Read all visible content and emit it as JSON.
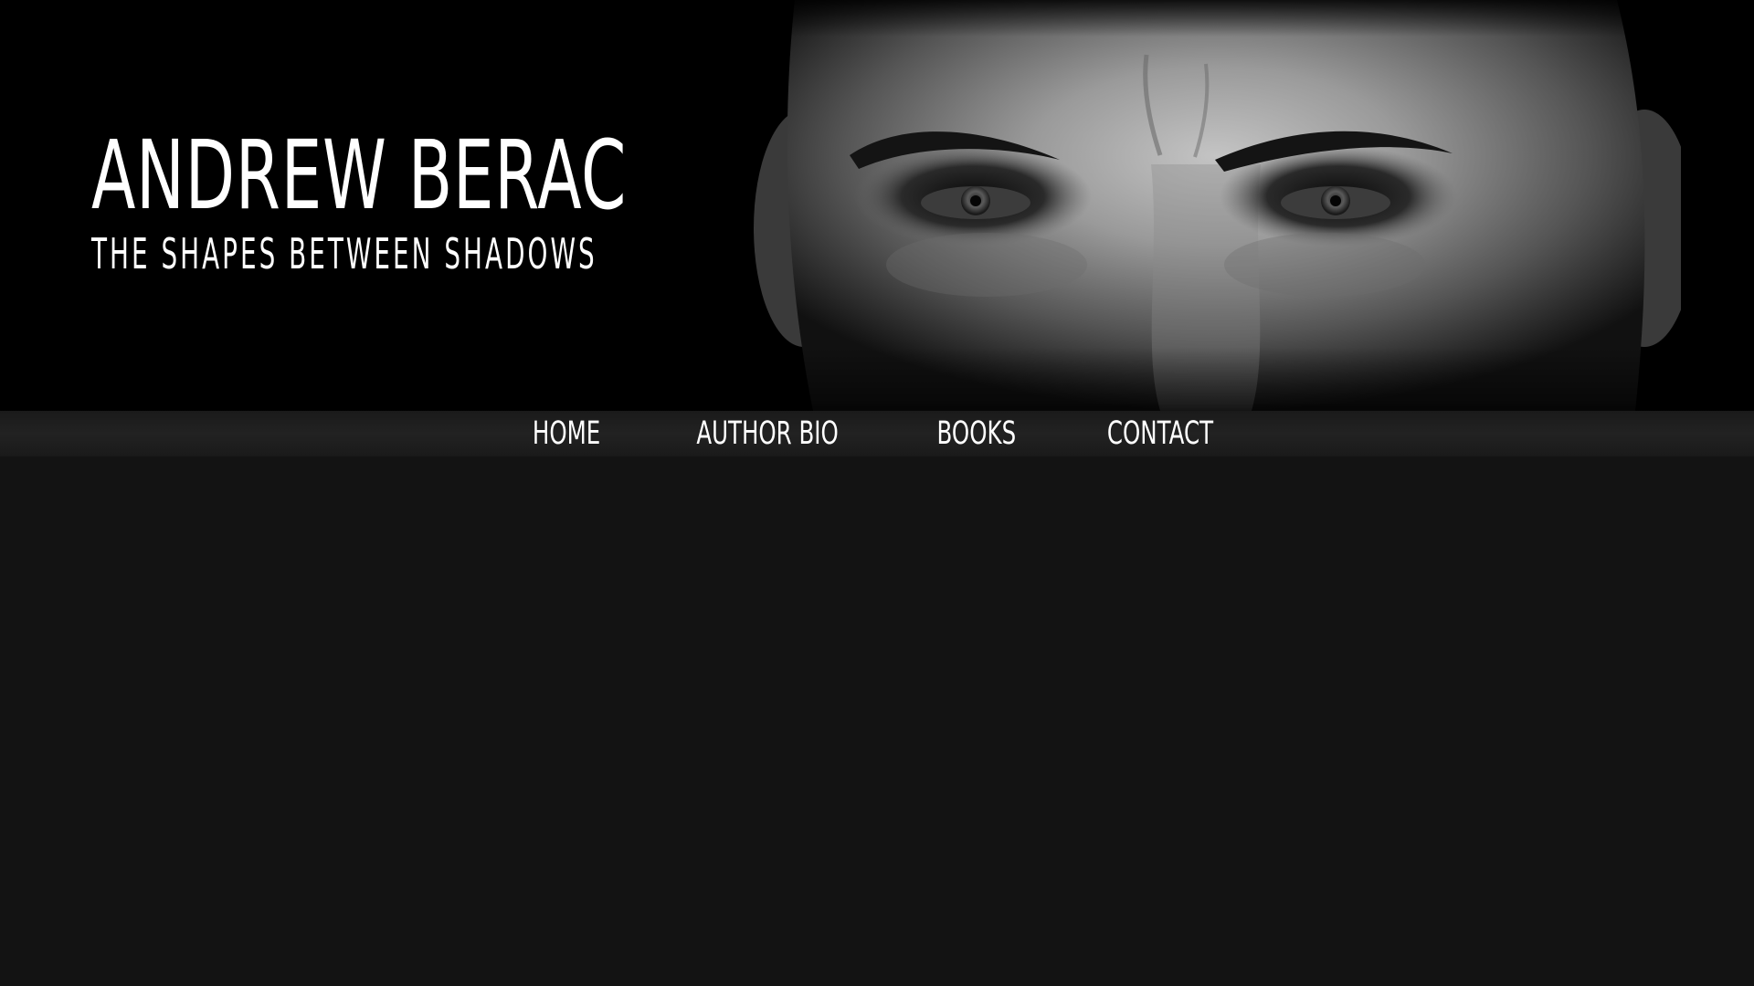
{
  "header": {
    "title": "ANDREW BERAC",
    "tagline": "THE SHAPES BETWEEN SHADOWS",
    "hero_image": "grayscale-portrait-upper-face"
  },
  "nav": {
    "items": [
      {
        "label": "HOME"
      },
      {
        "label": "AUTHOR BIO"
      },
      {
        "label": "BOOKS"
      },
      {
        "label": "CONTACT"
      }
    ]
  },
  "colors": {
    "header_bg": "#000000",
    "nav_bg": "#1e1e1e",
    "page_bg": "#131313",
    "text": "#ffffff"
  }
}
